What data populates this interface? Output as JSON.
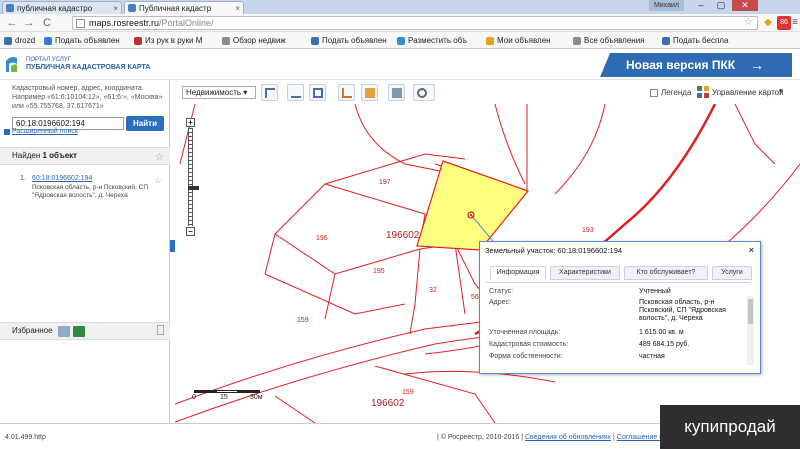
{
  "browser": {
    "tabs": [
      {
        "label": "публичная кадастро",
        "active": false
      },
      {
        "label": "Публичная кадастр",
        "active": true
      }
    ],
    "user": "Михаил",
    "controls": {
      "minimize": "–",
      "maximize": "▢",
      "close": "✕"
    },
    "nav": {
      "back": "←",
      "forward": "→",
      "reload": "C"
    },
    "url_host": "maps.rosreestr.ru",
    "url_path": "/PortalOnline/",
    "bookmarks": [
      {
        "label": "drozd",
        "color": "#3a6fb0"
      },
      {
        "label": "Подать объявлен",
        "color": "#2d7fd0"
      },
      {
        "label": "Из рук в руки М",
        "color": "#c0312f"
      },
      {
        "label": "Обзор недвиж",
        "color": "#8b8b8b"
      },
      {
        "label": "Подать объявлен",
        "color": "#3a6fb0"
      },
      {
        "label": "Разместить объ",
        "color": "#2e8fd6"
      },
      {
        "label": "Мои объявлен",
        "color": "#e2a51b"
      },
      {
        "label": "Все объявления",
        "color": "#8b8b8b"
      },
      {
        "label": "Подать беспла",
        "color": "#3a6fb0"
      }
    ]
  },
  "header": {
    "logo_top": "ПОРТАЛ УСЛУГ",
    "logo_main": "ПУБЛИЧНАЯ КАДАСТРОВАЯ КАРТА",
    "new_version": "Новая версия ПКК",
    "new_version_arrow": "→"
  },
  "sidebar": {
    "hint": "Кадастровый номер, адрес, координата. Например «61:6:10104:12», «61:6:», «Москва» или «55.755768, 37.617671»",
    "search_value": "60:18:0196602:194",
    "search_button": "Найти",
    "advanced": "Расширенный поиск",
    "found_prefix": "Найден",
    "found_count": "1 объект",
    "result": {
      "num": "1.",
      "number": "60:18:0196602:194",
      "address": "Псковская область, р-н Псковский, СП \"Ядровская волость\", д. Череха"
    },
    "favorites": "Избранное",
    "star": "☆"
  },
  "map_toolbar": {
    "layer": "Недвижимость",
    "layer_caret": "▾",
    "legend": "Легенда",
    "management": "Управление картой",
    "management_caret": "▾"
  },
  "map": {
    "labels": [
      "197",
      "196",
      "195",
      "196602",
      "193",
      "32",
      "56",
      "159",
      "159",
      "196602"
    ],
    "zoom_in": "+",
    "zoom_out": "−",
    "scale": [
      "0",
      "15",
      "30м"
    ],
    "highlight_color": "#ffff80",
    "parcel_color": "#e02020"
  },
  "popup": {
    "title": "Земельный участок: 60:18:0196602:194",
    "close": "×",
    "tabs": [
      "Информация",
      "Характеристики",
      "Кто обслуживает?",
      "Услуги"
    ],
    "rows": [
      {
        "k": "Статус:",
        "v": "Учтенный"
      },
      {
        "k": "Адрес:",
        "v": "Псковская область, р-н Псковский, СП \"Ядровская волость\", д. Череха"
      },
      {
        "k": "Уточненная площадь:",
        "v": "1 615.00 кв. м"
      },
      {
        "k": "Кадастровая стоимость:",
        "v": "489 684.15 руб."
      },
      {
        "k": "Форма собственности:",
        "v": "частная"
      }
    ]
  },
  "status": {
    "version": "4.01.499.http",
    "copyright": "| © Росреестр, 2010-2016 |",
    "link1": "Сведения об обновлениях",
    "sep": "|",
    "link2": "Соглашение об использовании"
  },
  "watermark": "купипродай"
}
